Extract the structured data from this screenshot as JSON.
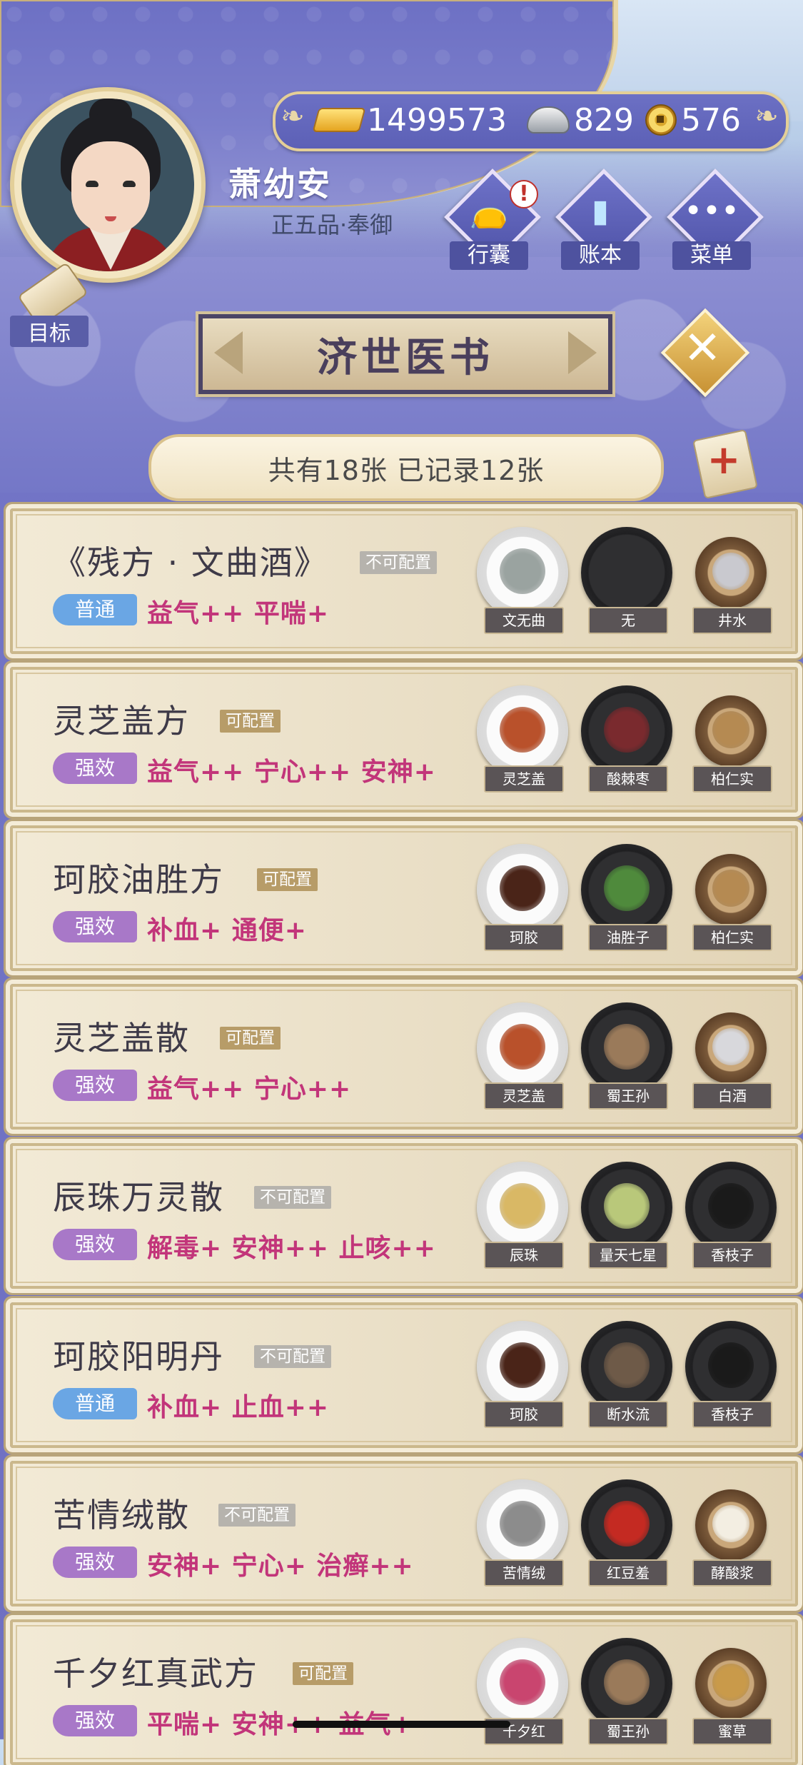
{
  "player": {
    "name": "萧幼安",
    "rank": "正五品·奉御"
  },
  "currency": {
    "gold": "1499573",
    "silver": "829",
    "coins": "576"
  },
  "menu": {
    "bag": "行囊",
    "ledger": "账本",
    "menu": "菜单",
    "bag_alert": "!"
  },
  "goal_label": "目标",
  "book_title": "济世医书",
  "count_text": "共有18张 已记录12张",
  "recipes": [
    {
      "name": "《残方 · 文曲酒》",
      "config": "不可配置",
      "grade": "普通",
      "effects": "益气++ 平喘+",
      "ingredients": [
        {
          "name": "文无曲",
          "plate": "white",
          "color": "#9aa3a0"
        },
        {
          "name": "无",
          "plate": "dark",
          "color": "#2f2f31"
        },
        {
          "name": "井水",
          "plate": "bowl",
          "color": "#c9c9cf"
        }
      ]
    },
    {
      "name": "灵芝盖方",
      "config": "可配置",
      "grade": "强效",
      "effects": "益气++ 宁心++ 安神+",
      "ingredients": [
        {
          "name": "灵芝盖",
          "plate": "white",
          "color": "#b9512b"
        },
        {
          "name": "酸棘枣",
          "plate": "dark",
          "color": "#7a2a2e"
        },
        {
          "name": "柏仁实",
          "plate": "bowl",
          "color": "#b58a52"
        }
      ]
    },
    {
      "name": "珂胶油胜方",
      "config": "可配置",
      "grade": "强效",
      "effects": "补血+ 通便+",
      "ingredients": [
        {
          "name": "珂胶",
          "plate": "white",
          "color": "#4a2418"
        },
        {
          "name": "油胜子",
          "plate": "dark",
          "color": "#4f8a3c"
        },
        {
          "name": "柏仁实",
          "plate": "bowl",
          "color": "#b58a52"
        }
      ]
    },
    {
      "name": "灵芝盖散",
      "config": "可配置",
      "grade": "强效",
      "effects": "益气++ 宁心++",
      "ingredients": [
        {
          "name": "灵芝盖",
          "plate": "white",
          "color": "#b9512b"
        },
        {
          "name": "蜀王孙",
          "plate": "dark",
          "color": "#9a7a5a"
        },
        {
          "name": "白酒",
          "plate": "bowl",
          "color": "#d8d8dc"
        }
      ]
    },
    {
      "name": "辰珠万灵散",
      "config": "不可配置",
      "grade": "强效",
      "effects": "解毒+ 安神++ 止咳++",
      "ingredients": [
        {
          "name": "辰珠",
          "plate": "white",
          "color": "#d9b865"
        },
        {
          "name": "量天七星",
          "plate": "dark",
          "color": "#b9c87a"
        },
        {
          "name": "香枝子",
          "plate": "dark",
          "color": "#1a1a1a"
        }
      ]
    },
    {
      "name": "珂胶阳明丹",
      "config": "不可配置",
      "grade": "普通",
      "effects": "补血+ 止血++",
      "ingredients": [
        {
          "name": "珂胶",
          "plate": "white",
          "color": "#4a2418"
        },
        {
          "name": "断水流",
          "plate": "dark",
          "color": "#6e5a48"
        },
        {
          "name": "香枝子",
          "plate": "dark",
          "color": "#1a1a1a"
        }
      ]
    },
    {
      "name": "苦情绒散",
      "config": "不可配置",
      "grade": "强效",
      "effects": "安神+ 宁心+ 治癣++",
      "ingredients": [
        {
          "name": "苦情绒",
          "plate": "white",
          "color": "#8c8c8c"
        },
        {
          "name": "红豆羞",
          "plate": "dark",
          "color": "#c42a22"
        },
        {
          "name": "酵酸浆",
          "plate": "bowl",
          "color": "#f3eee2"
        }
      ]
    },
    {
      "name": "千夕红真武方",
      "config": "可配置",
      "grade": "强效",
      "effects": "平喘+ 安神++ 益气+",
      "ingredients": [
        {
          "name": "千夕红",
          "plate": "white",
          "color": "#c9456f"
        },
        {
          "name": "蜀王孙",
          "plate": "dark",
          "color": "#9a7a5a"
        },
        {
          "name": "蜜草",
          "plate": "bowl",
          "color": "#c99a4a"
        }
      ]
    }
  ]
}
